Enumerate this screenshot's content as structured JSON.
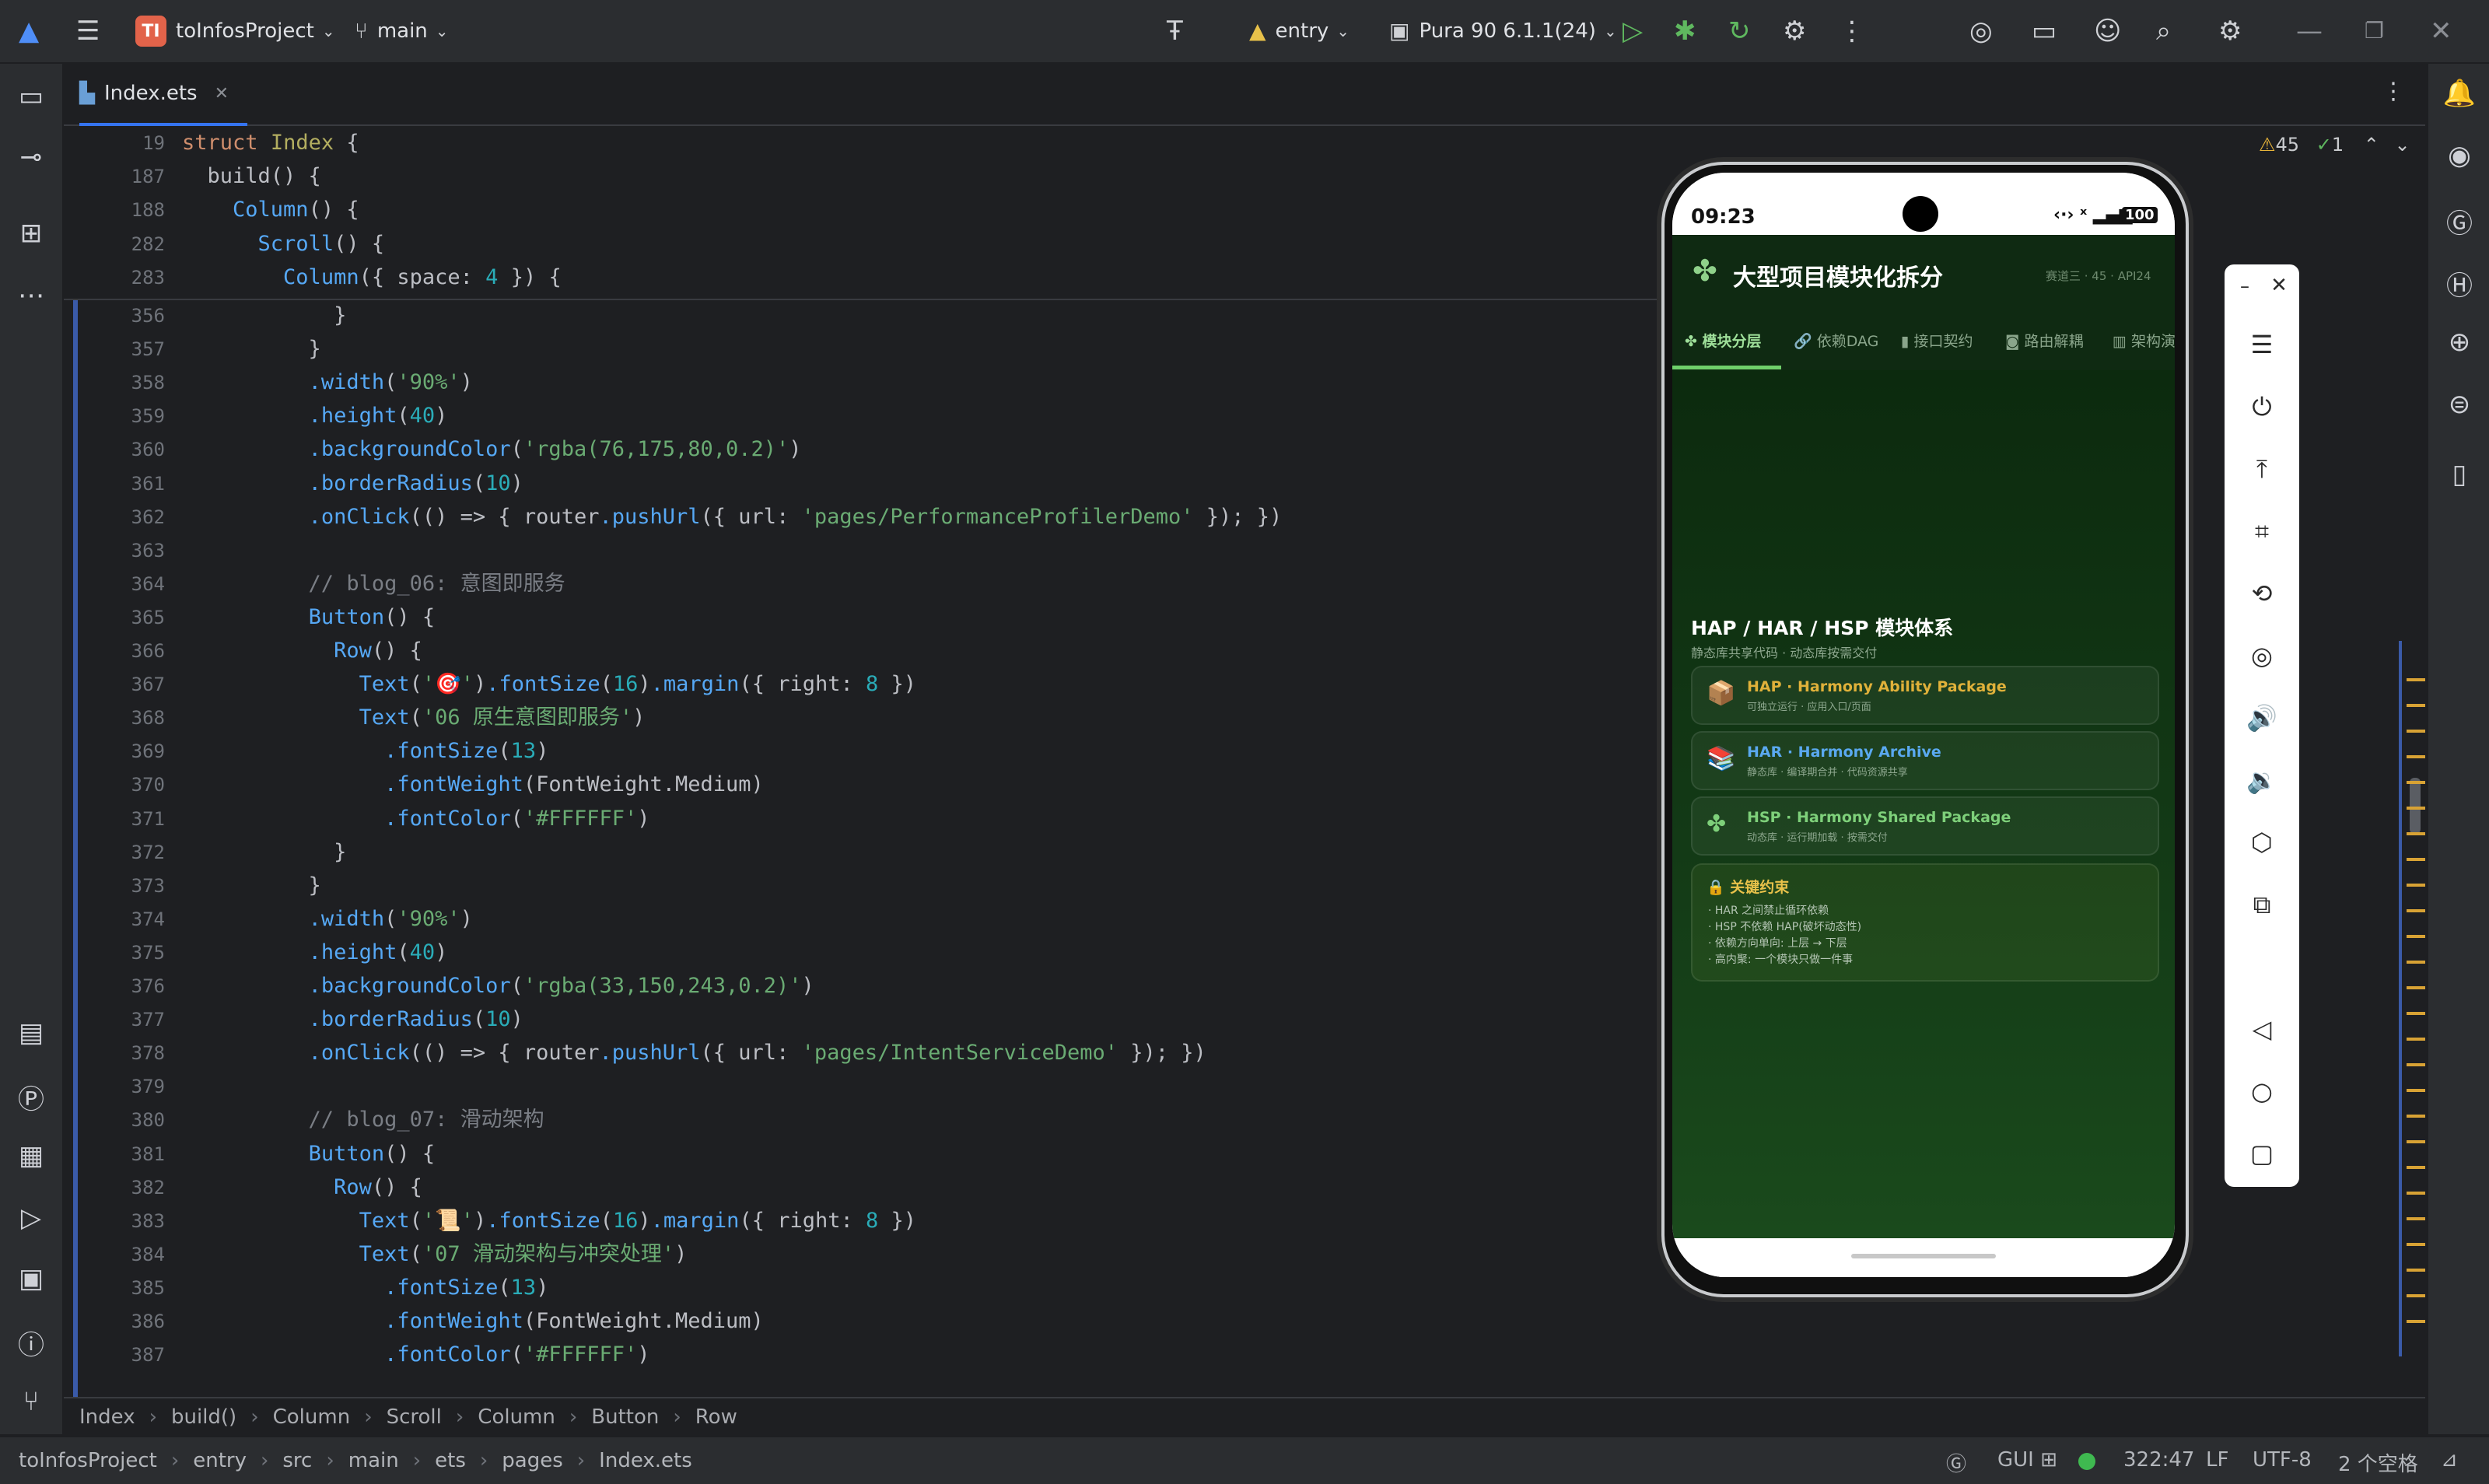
{
  "titlebar": {
    "project_initials": "TI",
    "project_name": "toInfosProject",
    "branch": "main",
    "run_config": "entry",
    "device": "Pura 90 6.1.1(24)"
  },
  "editor": {
    "tab_name": "Index.ets",
    "warnings": "45",
    "checks": "1",
    "sticky_lines": [
      {
        "n": "19",
        "code": "struct Index {"
      },
      {
        "n": "187",
        "code": "  build() {"
      },
      {
        "n": "188",
        "code": "    Column() {"
      },
      {
        "n": "282",
        "code": "      Scroll() {"
      },
      {
        "n": "283",
        "code": "        Column({ space: 4 }) {"
      }
    ],
    "lines": [
      {
        "n": "356",
        "code": "            }"
      },
      {
        "n": "357",
        "code": "          }"
      },
      {
        "n": "358",
        "code": "          .width('90%')"
      },
      {
        "n": "359",
        "code": "          .height(40)"
      },
      {
        "n": "360",
        "code": "          .backgroundColor('rgba(76,175,80,0.2)')"
      },
      {
        "n": "361",
        "code": "          .borderRadius(10)"
      },
      {
        "n": "362",
        "code": "          .onClick(() => { router.pushUrl({ url: 'pages/PerformanceProfilerDemo' }); })"
      },
      {
        "n": "363",
        "code": ""
      },
      {
        "n": "364",
        "code": "          // blog_06: 意图即服务"
      },
      {
        "n": "365",
        "code": "          Button() {"
      },
      {
        "n": "366",
        "code": "            Row() {"
      },
      {
        "n": "367",
        "code": "              Text('🎯').fontSize(16).margin({ right: 8 })"
      },
      {
        "n": "368",
        "code": "              Text('06 原生意图即服务')"
      },
      {
        "n": "369",
        "code": "                .fontSize(13)"
      },
      {
        "n": "370",
        "code": "                .fontWeight(FontWeight.Medium)"
      },
      {
        "n": "371",
        "code": "                .fontColor('#FFFFFF')"
      },
      {
        "n": "372",
        "code": "            }"
      },
      {
        "n": "373",
        "code": "          }"
      },
      {
        "n": "374",
        "code": "          .width('90%')"
      },
      {
        "n": "375",
        "code": "          .height(40)"
      },
      {
        "n": "376",
        "code": "          .backgroundColor('rgba(33,150,243,0.2)')"
      },
      {
        "n": "377",
        "code": "          .borderRadius(10)"
      },
      {
        "n": "378",
        "code": "          .onClick(() => { router.pushUrl({ url: 'pages/IntentServiceDemo' }); })"
      },
      {
        "n": "379",
        "code": ""
      },
      {
        "n": "380",
        "code": "          // blog_07: 滑动架构"
      },
      {
        "n": "381",
        "code": "          Button() {"
      },
      {
        "n": "382",
        "code": "            Row() {"
      },
      {
        "n": "383",
        "code": "              Text('📜').fontSize(16).margin({ right: 8 })"
      },
      {
        "n": "384",
        "code": "              Text('07 滑动架构与冲突处理')"
      },
      {
        "n": "385",
        "code": "                .fontSize(13)"
      },
      {
        "n": "386",
        "code": "                .fontWeight(FontWeight.Medium)"
      },
      {
        "n": "387",
        "code": "                .fontColor('#FFFFFF')"
      }
    ]
  },
  "breadcrumb": [
    "Index",
    "build()",
    "Column",
    "Scroll",
    "Column",
    "Button",
    "Row"
  ],
  "statusbar": {
    "path": [
      "toInfosProject",
      "entry",
      "src",
      "main",
      "ets",
      "pages",
      "Index.ets"
    ],
    "gui": "GUI",
    "position": "322:47",
    "line_sep": "LF",
    "encoding": "UTF-8",
    "indent": "2 个空格"
  },
  "phone": {
    "time": "09:23",
    "battery": "100",
    "app_title": "大型项目模块化拆分",
    "app_meta": "赛道三 · 45 · API24",
    "tabs": [
      "模块分层",
      "依赖DAG",
      "接口契约",
      "路由解耦",
      "架构演"
    ],
    "section_title": "HAP / HAR / HSP 模块体系",
    "section_sub": "静态库共享代码 · 动态库按需交付",
    "cards": [
      {
        "title": "HAP · Harmony Ability Package",
        "sub": "可独立运行 · 应用入口/页面",
        "color": "#e0b13a"
      },
      {
        "title": "HAR · Harmony Archive",
        "sub": "静态库 · 编译期合并 · 代码资源共享",
        "color": "#5aa9f0"
      },
      {
        "title": "HSP · Harmony Shared Package",
        "sub": "动态库 · 运行期加载 · 按需交付",
        "color": "#7ed07a"
      }
    ],
    "constraints_title": "关键约束",
    "constraints": [
      "· HAR 之间禁止循环依赖",
      "· HSP 不依赖 HAP(破坏动态性)",
      "· 依赖方向单向: 上层 → 下层",
      "· 高内聚: 一个模块只做一件事"
    ]
  }
}
